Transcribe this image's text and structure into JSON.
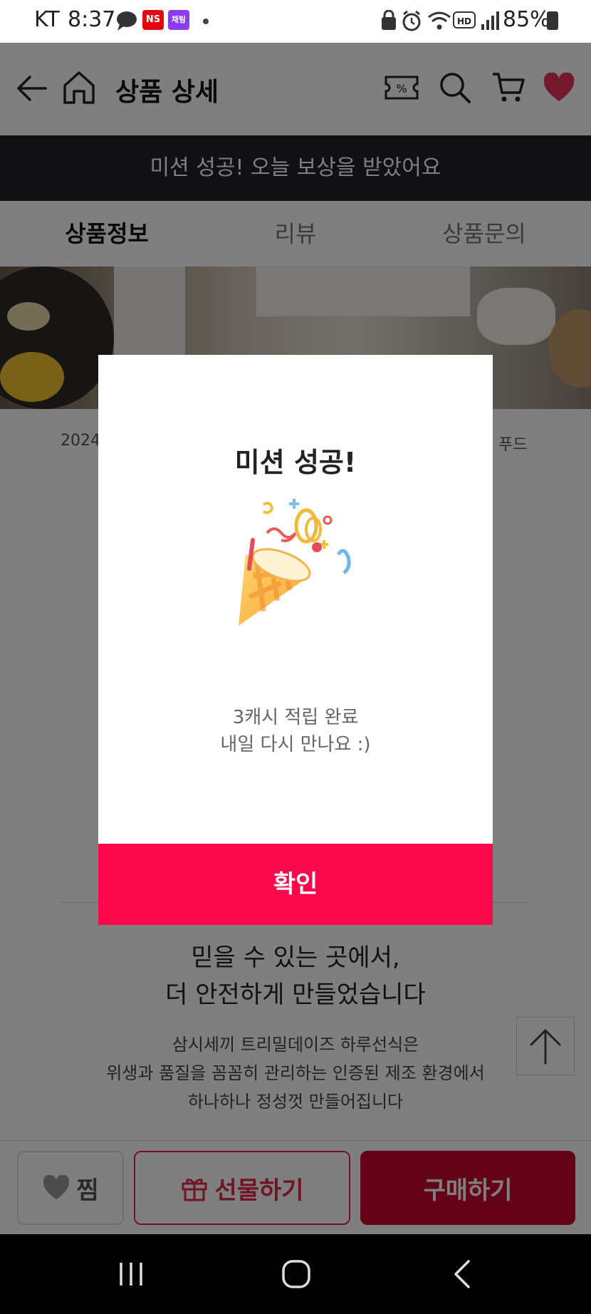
{
  "status_bar": {
    "carrier": "KT",
    "time": "8:37",
    "badge_ns": "NS",
    "badge_app": "채팅",
    "battery": "85%"
  },
  "header": {
    "title": "상품 상세"
  },
  "banner": {
    "text": "미션 성공! 오늘 보상을 받았어요"
  },
  "tabs": [
    {
      "label": "상품정보",
      "active": true
    },
    {
      "label": "리뷰",
      "active": false
    },
    {
      "label": "상품문의",
      "active": false
    }
  ],
  "info_row": {
    "left_text": "2024",
    "right_text": "푸드"
  },
  "content": {
    "headline_line1": "믿을 수 있는 곳에서,",
    "headline_line2": "더 안전하게 만들었습니다",
    "desc_line1": "삼시세끼 트리밀데이즈 하루선식은",
    "desc_line2": "위생과 품질을 꼼꼼히 관리하는 인증된 제조 환경에서",
    "desc_line3": "하나하나 정성껏 만들어집니다"
  },
  "bottom_bar": {
    "wish_label": "찜",
    "gift_label": "선물하기",
    "buy_label": "구매하기"
  },
  "modal": {
    "title": "미션 성공!",
    "message_line1": "3캐시 적립 완료",
    "message_line2": "내일 다시 만나요 :)",
    "confirm_label": "확인",
    "illustration": "party-popper-icon"
  },
  "colors": {
    "accent": "#fa0a4a",
    "buy_button": "#c8072f",
    "banner": "#222226",
    "heart": "#e8305a"
  }
}
